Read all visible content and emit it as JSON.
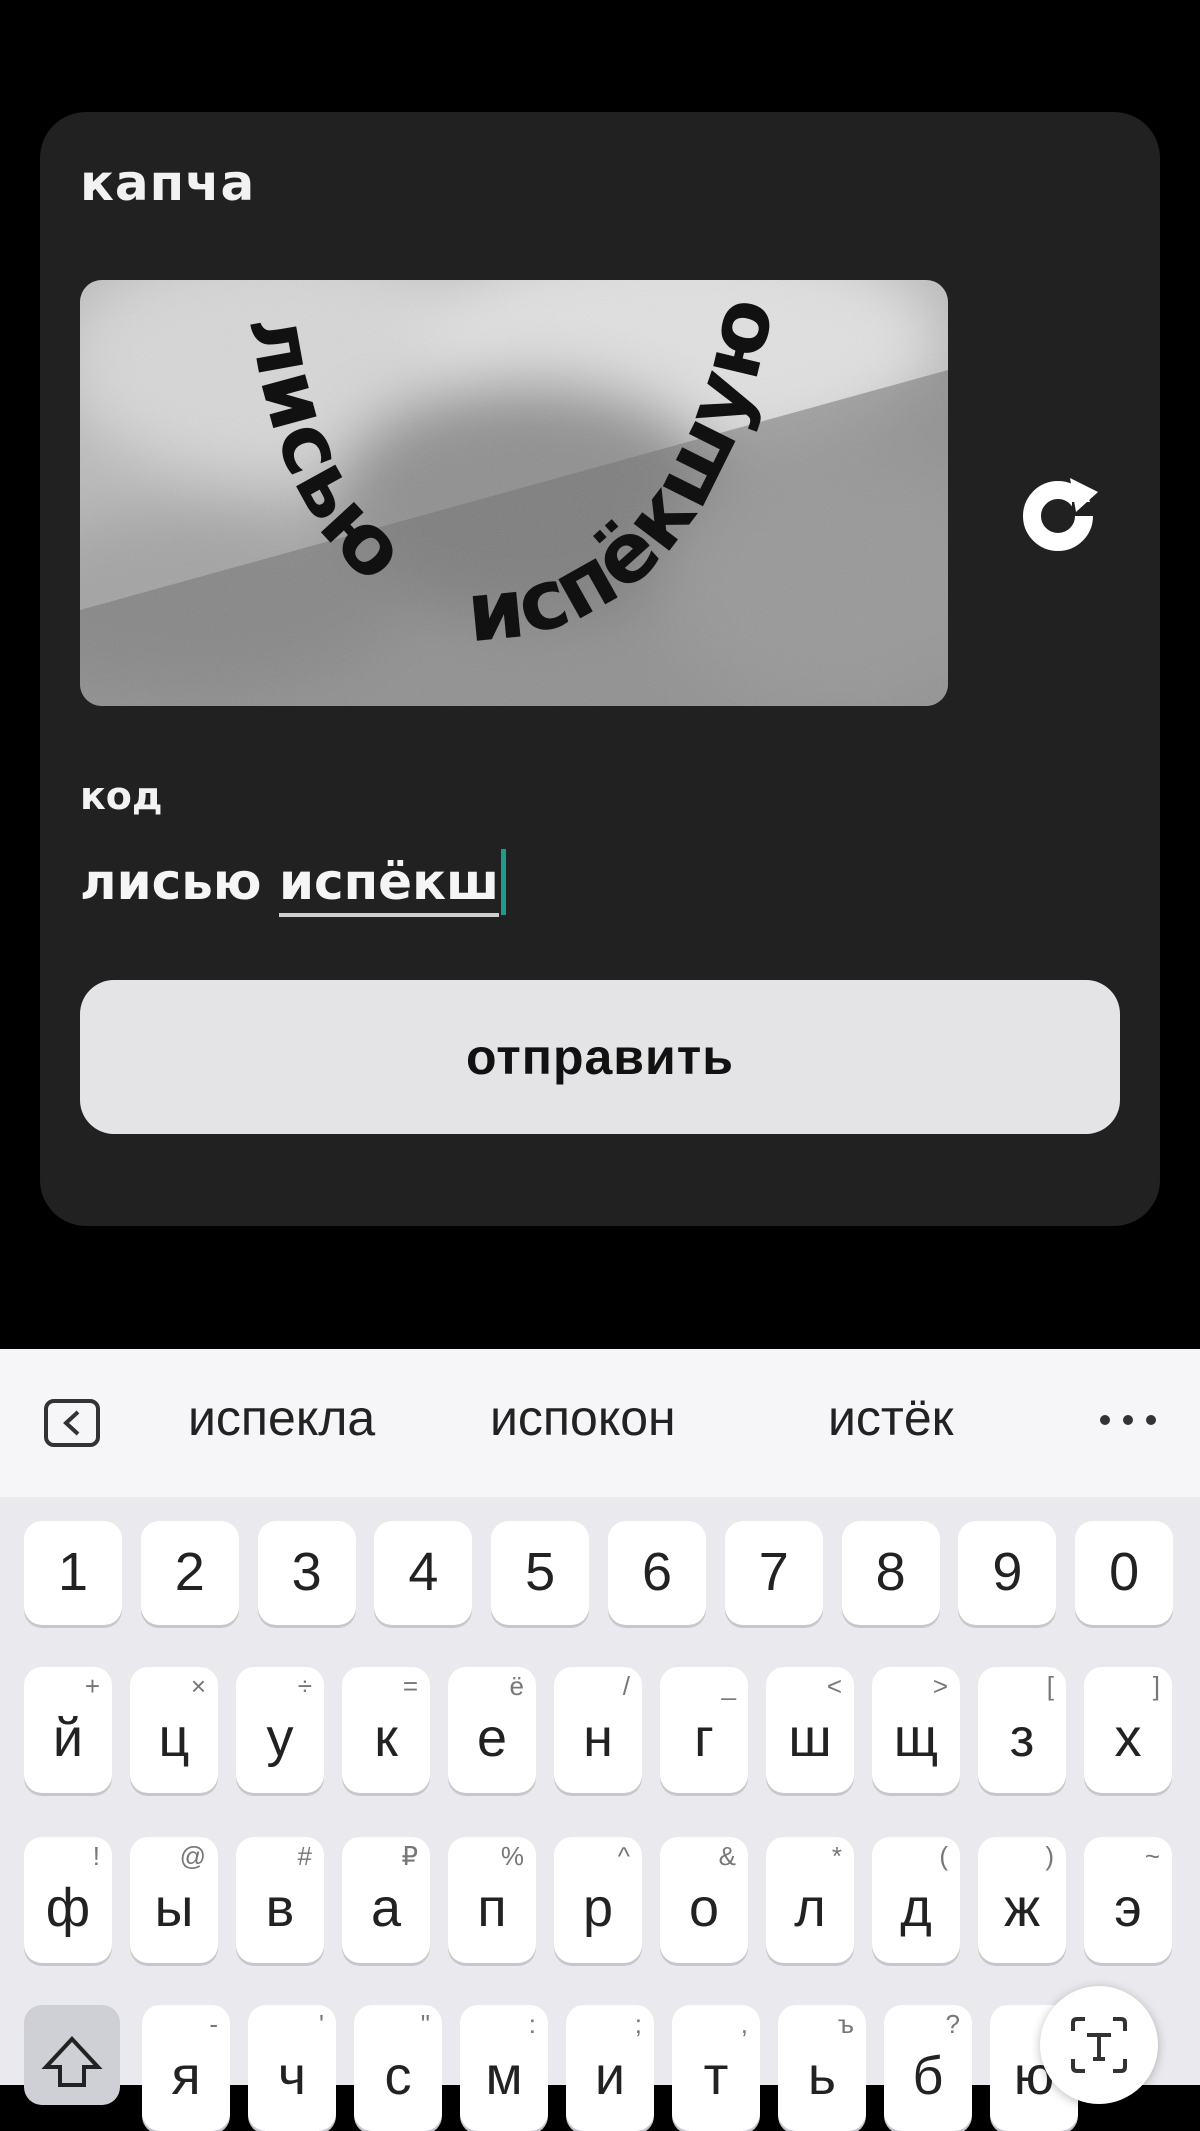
{
  "card": {
    "title": "капча",
    "captcha_text_line1": "лисью",
    "captcha_text_line2": "испёкшую",
    "code_label": "код",
    "code_value_part1": "лисью ",
    "code_value_part2": "испёкш",
    "submit_label": "отправить",
    "refresh_icon": "refresh-icon"
  },
  "keyboard": {
    "suggestions": [
      "испекла",
      "испокон",
      "истёк"
    ],
    "number_row": [
      "1",
      "2",
      "3",
      "4",
      "5",
      "6",
      "7",
      "8",
      "9",
      "0"
    ],
    "row1": [
      {
        "key": "й",
        "hint": "+"
      },
      {
        "key": "ц",
        "hint": "×"
      },
      {
        "key": "у",
        "hint": "÷"
      },
      {
        "key": "к",
        "hint": "="
      },
      {
        "key": "е",
        "hint": "ё"
      },
      {
        "key": "н",
        "hint": "/"
      },
      {
        "key": "г",
        "hint": "_"
      },
      {
        "key": "ш",
        "hint": "<"
      },
      {
        "key": "щ",
        "hint": ">"
      },
      {
        "key": "з",
        "hint": "["
      },
      {
        "key": "х",
        "hint": "]"
      }
    ],
    "row2": [
      {
        "key": "ф",
        "hint": "!"
      },
      {
        "key": "ы",
        "hint": "@"
      },
      {
        "key": "в",
        "hint": "#"
      },
      {
        "key": "а",
        "hint": "₽"
      },
      {
        "key": "п",
        "hint": "%"
      },
      {
        "key": "р",
        "hint": "^"
      },
      {
        "key": "о",
        "hint": "&"
      },
      {
        "key": "л",
        "hint": "*"
      },
      {
        "key": "д",
        "hint": "("
      },
      {
        "key": "ж",
        "hint": ")"
      },
      {
        "key": "э",
        "hint": "~"
      }
    ],
    "row3": [
      {
        "key": "я",
        "hint": "-"
      },
      {
        "key": "ч",
        "hint": "'"
      },
      {
        "key": "с",
        "hint": "\""
      },
      {
        "key": "м",
        "hint": ":"
      },
      {
        "key": "и",
        "hint": ";"
      },
      {
        "key": "т",
        "hint": ","
      },
      {
        "key": "ь",
        "hint": "ъ"
      },
      {
        "key": "б",
        "hint": "?"
      },
      {
        "key": "ю",
        "hint": ""
      }
    ],
    "shift_icon": "shift-icon",
    "collapse_icon": "chevron-left-icon",
    "more_icon": "more-dots-icon",
    "text_scan_icon": "text-scan-icon"
  }
}
